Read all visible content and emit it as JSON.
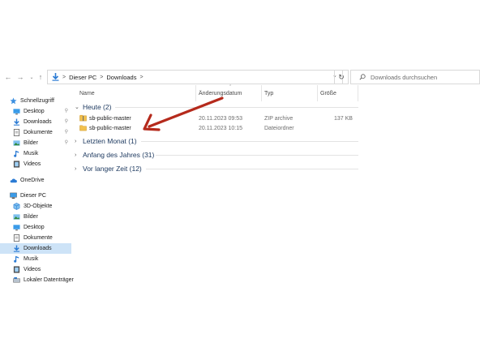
{
  "toolbar": {
    "back_icon": "arrow-left-icon",
    "forward_icon": "arrow-right-icon",
    "recent_icon": "chevron-down-icon",
    "up_icon": "arrow-up-icon"
  },
  "address": {
    "crumbs": [
      "Dieser PC",
      "Downloads"
    ],
    "separator": ">"
  },
  "search": {
    "placeholder": "Downloads durchsuchen"
  },
  "columns": {
    "name": "Name",
    "date": "Änderungsdatum",
    "type": "Typ",
    "size": "Größe"
  },
  "sidebar": {
    "quick_access": "Schnellzugriff",
    "quick_items": [
      {
        "label": "Desktop",
        "icon": "desktop-icon"
      },
      {
        "label": "Downloads",
        "icon": "download-icon"
      },
      {
        "label": "Dokumente",
        "icon": "document-icon"
      },
      {
        "label": "Bilder",
        "icon": "pictures-icon"
      },
      {
        "label": "Musik",
        "icon": "music-icon"
      },
      {
        "label": "Videos",
        "icon": "video-icon"
      }
    ],
    "onedrive": "OneDrive",
    "this_pc": "Dieser PC",
    "pc_items": [
      {
        "label": "3D-Objekte",
        "icon": "cube-icon"
      },
      {
        "label": "Bilder",
        "icon": "pictures-icon"
      },
      {
        "label": "Desktop",
        "icon": "desktop-icon"
      },
      {
        "label": "Dokumente",
        "icon": "document-icon"
      },
      {
        "label": "Downloads",
        "icon": "download-icon"
      },
      {
        "label": "Musik",
        "icon": "music-icon"
      },
      {
        "label": "Videos",
        "icon": "video-icon"
      },
      {
        "label": "Lokaler Datenträger",
        "icon": "drive-icon"
      }
    ]
  },
  "groups": {
    "today": "Heute (2)",
    "last_month": "Letzten Monat (1)",
    "start_of_year": "Anfang des Jahres (31)",
    "long_ago": "Vor langer Zeit (12)"
  },
  "files": [
    {
      "name": "sb-public-master",
      "date": "20.11.2023 09:53",
      "type": "ZIP archive",
      "size": "137 KB",
      "icon": "zip-folder-icon"
    },
    {
      "name": "sb-public-master",
      "date": "20.11.2023 10:15",
      "type": "Dateiordner",
      "size": "",
      "icon": "folder-icon"
    }
  ],
  "colors": {
    "accent": "#2b7bd4",
    "selection": "#cde3f7",
    "annotation_arrow": "#b52a1c",
    "folder": "#f2c14e"
  }
}
